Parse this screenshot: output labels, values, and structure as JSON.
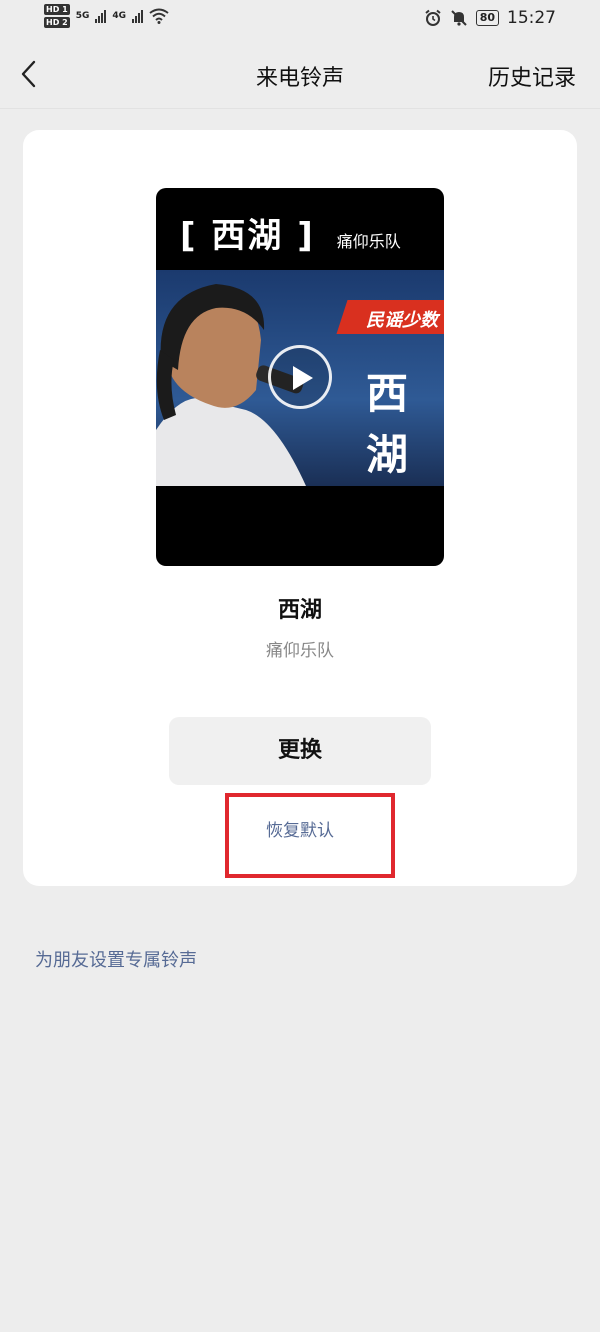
{
  "status_bar": {
    "hd1": "HD 1",
    "hd2": "HD 2",
    "net1": "5G",
    "net2": "4G",
    "battery": "80",
    "time": "15:27"
  },
  "nav": {
    "title": "来电铃声",
    "history_label": "历史记录"
  },
  "cover": {
    "song": "[ 西湖 ]",
    "artist": "痛仰乐队",
    "ribbon_text": "民谣少数",
    "big_text": "西 湖"
  },
  "song": {
    "title": "西湖",
    "artist": "痛仰乐队"
  },
  "actions": {
    "change_label": "更换",
    "reset_label": "恢复默认"
  },
  "friend_link": "为朋友设置专属铃声",
  "colors": {
    "background": "#ededed",
    "link": "#576b95",
    "highlight": "#e0282e"
  }
}
